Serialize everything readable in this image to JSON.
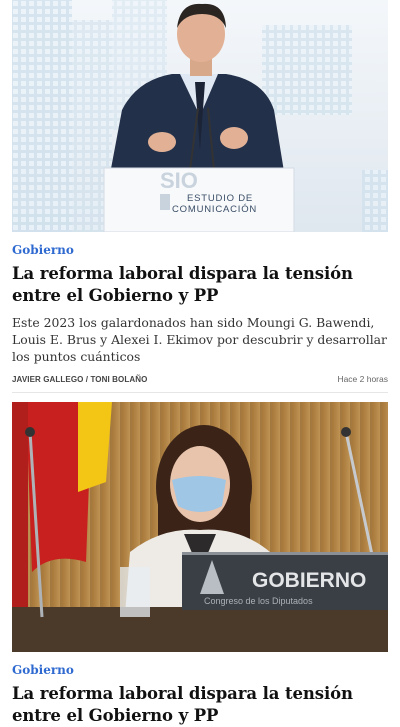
{
  "articles": [
    {
      "category": "Gobierno",
      "headline": "La reforma laboral dispara la tensión entre el Gobierno y PP",
      "summary": "Este 2023 los galardonados han sido Moungi G. Bawendi, Louis E. Brus y Alexei I. Ekimov por descubrir y desarrollar los puntos cuánticos",
      "authors": "JAVIER GALLEGO / TONI BOLAÑO",
      "time": "Hace 2 horas",
      "image": {
        "podium_line1": "ESTUDIO DE",
        "podium_line2": "COMUNICACIÓN",
        "logo_text": "SIO"
      }
    },
    {
      "category": "Gobierno",
      "headline": "La reforma laboral dispara la tensión entre el Gobierno y PP",
      "image": {
        "nameplate": "GOBIERNO",
        "nameplate_sub": "Congreso de los Diputados"
      }
    }
  ],
  "colors": {
    "category": "#2f6ad0",
    "headline": "#111111"
  }
}
